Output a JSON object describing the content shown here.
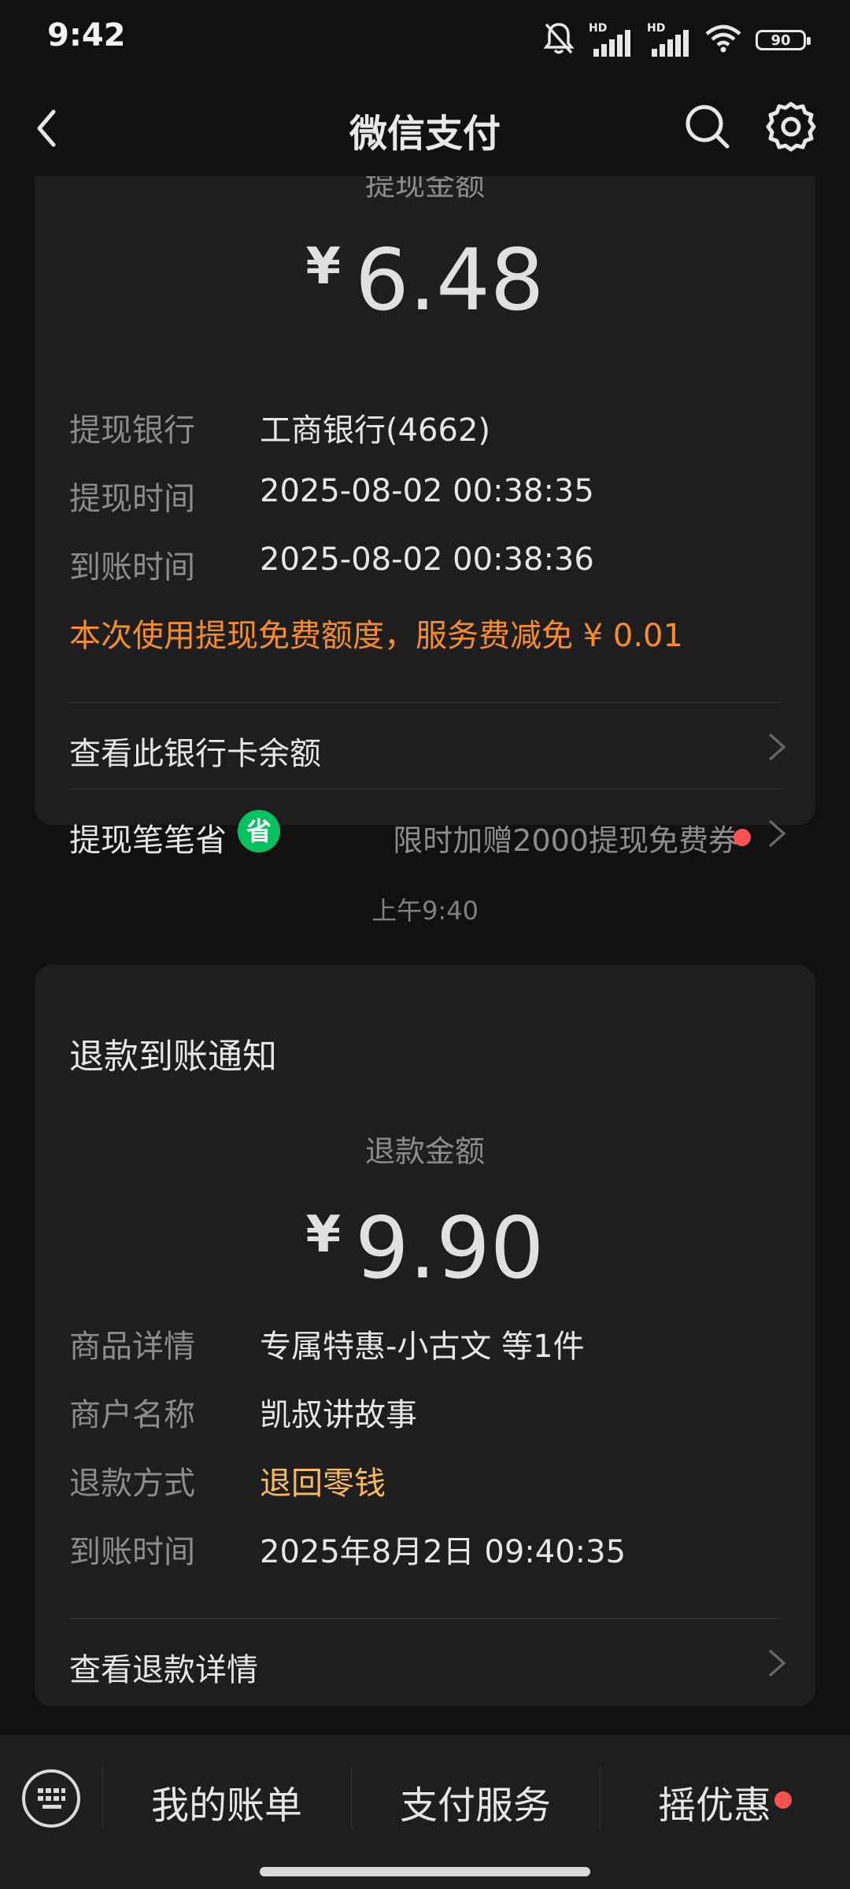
{
  "status_bar": {
    "time": "9:42",
    "signal_badge": "HD",
    "battery_level": "90",
    "icons": [
      "bell-muted-icon",
      "signal-hd-icon",
      "signal-hd-icon",
      "wifi-icon",
      "battery-icon"
    ]
  },
  "nav": {
    "title": "微信支付",
    "icons": [
      "back-icon",
      "search-icon",
      "gear-icon"
    ]
  },
  "withdraw_card": {
    "amount_label": "提现金额",
    "currency": "¥",
    "amount": "6.48",
    "rows": [
      {
        "label": "提现银行",
        "value": "工商银行(4662)"
      },
      {
        "label": "提现时间",
        "value": "2025-08-02 00:38:35"
      },
      {
        "label": "到账时间",
        "value": "2025-08-02 00:38:36"
      }
    ],
    "notice": "本次使用提现免费额度，服务费减免 ¥ 0.01",
    "link_balance": "查看此银行卡余额",
    "link_save": "提现笔笔省",
    "save_badge": "省",
    "promo": "限时加赠2000提现免费券"
  },
  "time_separator": "上午9:40",
  "refund_card": {
    "title": "退款到账通知",
    "amount_label": "退款金额",
    "currency": "¥",
    "amount": "9.90",
    "rows": [
      {
        "label": "商品详情",
        "value": "专属特惠-小古文 等1件"
      },
      {
        "label": "商户名称",
        "value": "凯叔讲故事"
      },
      {
        "label": "退款方式",
        "value": "退回零钱"
      },
      {
        "label": "到账时间",
        "value": "2025年8月2日 09:40:35"
      }
    ],
    "link_detail": "查看退款详情"
  },
  "bottom_menu": {
    "items": [
      "我的账单",
      "支付服务",
      "摇优惠"
    ]
  },
  "colors": {
    "background": "#111111",
    "card": "#1e1e1e",
    "notice_orange": "#f58d2e",
    "refund_method_orange": "#f7ba5d",
    "badge_green": "#07c160",
    "dot_red": "#fa5151"
  }
}
